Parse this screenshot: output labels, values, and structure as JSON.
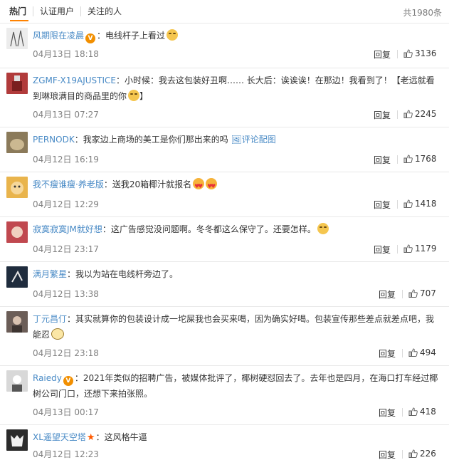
{
  "tabs": [
    {
      "label": "热门"
    },
    {
      "label": "认证用户"
    },
    {
      "label": "关注的人"
    }
  ],
  "total": "共1980条",
  "reply_label": "回复",
  "colors": {
    "link": "#4a8bc6",
    "accent": "#ff8200",
    "meta": "#808080"
  },
  "comments": [
    {
      "user": "风期限在凌晨",
      "badge": "v-badge",
      "content": "：电线杆子上看过",
      "emoji": "smug-emoji",
      "time": "04月13日 18:18",
      "likes": "3136",
      "avatar_color": "#ececec"
    },
    {
      "user": "ZGMF-X19AJUSTICE",
      "content": "：小时候：我去这包装好丑啊…… 长大后：诶诶诶！在那边！我看到了！【老远就看到琳琅满目的商品里的你",
      "emoji": "smug-emoji",
      "content_tail": "】",
      "time": "04月13日 07:27",
      "likes": "2245",
      "avatar_color": "#b13b3b"
    },
    {
      "user": "PERNODK",
      "content": "：我家边上商场的美工是你们那出来的吗",
      "extra_link": "评论配图",
      "time": "04月12日 16:19",
      "likes": "1768",
      "avatar_color": "#8b7a5a"
    },
    {
      "user": "我不瘦谁瘦·养老版",
      "content": "：送我20箱椰汁就报名",
      "emoji": "love-emoji",
      "emoji2": "love-emoji",
      "time": "04月12日 12:29",
      "likes": "1418",
      "avatar_color": "#e9b44c"
    },
    {
      "user": "寂寞寂寞JM就好想",
      "content": "：这广告感觉没问题啊。冬冬都这么保守了。还要怎样。",
      "emoji": "smug-emoji",
      "time": "04月12日 23:17",
      "likes": "1179",
      "avatar_color": "#c0484f"
    },
    {
      "user": "满月繁星",
      "content": "：我以为站在电线杆旁边了。",
      "time": "04月12日 13:38",
      "likes": "707",
      "avatar_color": "#1f2c3d"
    },
    {
      "user": "丁元昌仃",
      "content": "：其实就算你的包装设计成一坨屎我也会买来喝，因为确实好喝。包装宣传那些差点就差点吧，我能忍",
      "emoji": "glasses-emoji",
      "time": "04月12日 23:18",
      "likes": "494",
      "avatar_color": "#6b5d57"
    },
    {
      "user": "Raiedy",
      "badge": "v-badge",
      "content": "：2021年类似的招聘广告，被媒体批评了，椰树硬怼回去了。去年也是四月，在海口打车经过椰树公司门口，还想下来拍张照。",
      "time": "04月13日 00:17",
      "likes": "418",
      "avatar_color": "#d8d8d8"
    },
    {
      "user": "XL遥望天空塔",
      "badge": "star-badge",
      "content": "：这风格牛逼",
      "time": "04月12日 12:23",
      "likes": "226",
      "avatar_color": "#2b2b2b"
    }
  ]
}
